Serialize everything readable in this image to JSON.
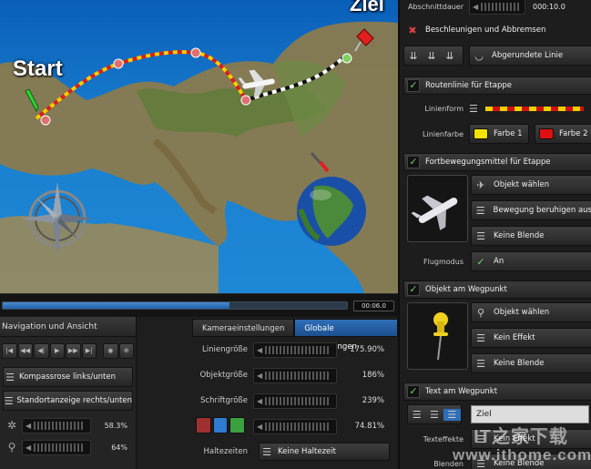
{
  "map": {
    "start_label": "Start",
    "end_label": "Ziel",
    "compass_letters": [
      "N",
      "S"
    ]
  },
  "timeline": {
    "progress": 0.66,
    "time": "00:06.0"
  },
  "nav": {
    "title": "Navigation und Ansicht",
    "compass_button": "Kompassrose links/unten",
    "position_button": "Standortanzeige rechts/unten",
    "slider1_value": "58.3%",
    "slider2_value": "64%"
  },
  "settings": {
    "tab_camera": "Kameraeinstellungen",
    "tab_global": "Globale Einstellungen",
    "line_size_label": "Liniengröße",
    "line_size_value": "175.90%",
    "object_size_label": "Objektgröße",
    "object_size_value": "186%",
    "font_size_label": "Schriftgröße",
    "font_size_value": "239%",
    "extra_value": "74.81%",
    "stops_label": "Haltezeiten",
    "stops_value": "Keine Haltezeit"
  },
  "panel": {
    "section_duration": "Abschnittdauer",
    "duration_value": "000:10.0",
    "accel_label": "Beschleunigen und Abbremsen",
    "rounded_line": "Abgerundete Linie",
    "route_section": "Routenlinie für Etappe",
    "line_shape_label": "Linienform",
    "line_color_label": "Linienfarbe",
    "color1": "Farbe 1",
    "color2": "Farbe 2",
    "vehicle_section": "Fortbewegungsmittel für Etappe",
    "choose_object": "Objekt wählen",
    "calm_motion": "Bewegung beruhigen aus",
    "no_blend": "Keine Blende",
    "flight_mode_label": "Flugmodus",
    "flight_mode_value": "An",
    "waypoint_object_section": "Objekt am Wegpunkt",
    "choose_object2": "Objekt wählen",
    "no_effect": "Kein Effekt",
    "no_blend2": "Keine Blende",
    "waypoint_text_section": "Text am Wegpunkt",
    "text_value": "Ziel",
    "text_effect_label": "Texteffekte",
    "text_effect_value": "Kein Effekt",
    "blend_label": "Blenden",
    "blend_value": "Keine Blende"
  },
  "colors": {
    "color1": "#f5e200",
    "color2": "#e01010",
    "accent": "#2f6fb8"
  },
  "watermark": {
    "line1": "IT之家下载",
    "line2": "www.ithome.com"
  }
}
